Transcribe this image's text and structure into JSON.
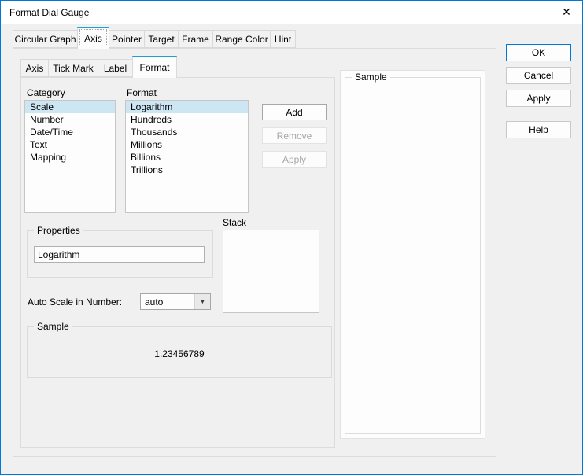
{
  "window": {
    "title": "Format Dial Gauge",
    "close_icon": "✕"
  },
  "main_tabs": [
    {
      "label": "Circular Graph"
    },
    {
      "label": "Axis"
    },
    {
      "label": "Pointer"
    },
    {
      "label": "Target"
    },
    {
      "label": "Frame"
    },
    {
      "label": "Range Color"
    },
    {
      "label": "Hint"
    }
  ],
  "sub_tabs": [
    {
      "label": "Axis"
    },
    {
      "label": "Tick Mark"
    },
    {
      "label": "Label"
    },
    {
      "label": "Format"
    }
  ],
  "format_tab": {
    "category": {
      "label": "Category",
      "items": [
        "Scale",
        "Number",
        "Date/Time",
        "Text",
        "Mapping"
      ],
      "selected": "Scale"
    },
    "format": {
      "label": "Format",
      "items": [
        "Logarithm",
        "Hundreds",
        "Thousands",
        "Millions",
        "Billions",
        "Trillions"
      ],
      "selected": "Logarithm"
    },
    "add_button": "Add",
    "remove_button": "Remove",
    "apply_button": "Apply",
    "properties": {
      "label": "Properties",
      "value": "Logarithm"
    },
    "stack": {
      "label": "Stack"
    },
    "auto_scale": {
      "label": "Auto Scale in Number:",
      "value": "auto",
      "dropdown_icon": "▼"
    },
    "sample": {
      "label": "Sample",
      "value": "1.23456789"
    }
  },
  "preview": {
    "label": "Sample"
  },
  "dialog_buttons": {
    "ok": "OK",
    "cancel": "Cancel",
    "apply": "Apply",
    "help": "Help"
  },
  "colors": {
    "accent": "#0078d7",
    "tab_accent": "#19a0dc",
    "selection": "#cde6f4"
  }
}
